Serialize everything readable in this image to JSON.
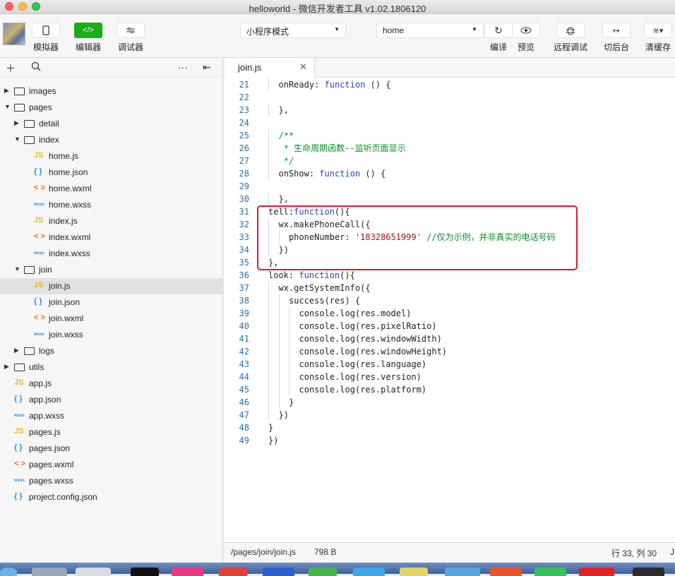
{
  "window": {
    "title": "helloworld - 微信开发者工具 v1.02.1806120"
  },
  "toolbar": {
    "simulator": "模拟器",
    "editor": "编辑器",
    "debugger": "调试器",
    "mode_select": "小程序模式",
    "page_select": "home",
    "compile": "编译",
    "preview": "预览",
    "remote_debug": "远程调试",
    "background": "切后台",
    "clear_cache": "清缓存"
  },
  "sidebar": {
    "tree": [
      {
        "label": "images",
        "type": "folder",
        "depth": 0,
        "expanded": false
      },
      {
        "label": "pages",
        "type": "folder",
        "depth": 0,
        "expanded": true
      },
      {
        "label": "detail",
        "type": "folder",
        "depth": 1,
        "expanded": false
      },
      {
        "label": "index",
        "type": "folder",
        "depth": 1,
        "expanded": true
      },
      {
        "label": "home.js",
        "type": "js",
        "depth": 2
      },
      {
        "label": "home.json",
        "type": "json",
        "depth": 2
      },
      {
        "label": "home.wxml",
        "type": "wxml",
        "depth": 2
      },
      {
        "label": "home.wxss",
        "type": "wxss",
        "depth": 2
      },
      {
        "label": "index.js",
        "type": "js",
        "depth": 2
      },
      {
        "label": "index.wxml",
        "type": "wxml",
        "depth": 2
      },
      {
        "label": "index.wxss",
        "type": "wxss",
        "depth": 2
      },
      {
        "label": "join",
        "type": "folder",
        "depth": 1,
        "expanded": true
      },
      {
        "label": "join.js",
        "type": "js",
        "depth": 2,
        "selected": true
      },
      {
        "label": "join.json",
        "type": "json",
        "depth": 2
      },
      {
        "label": "join.wxml",
        "type": "wxml",
        "depth": 2
      },
      {
        "label": "join.wxss",
        "type": "wxss",
        "depth": 2
      },
      {
        "label": "logs",
        "type": "folder",
        "depth": 1,
        "expanded": false
      },
      {
        "label": "utils",
        "type": "folder",
        "depth": 0,
        "expanded": false
      },
      {
        "label": "app.js",
        "type": "js",
        "depth": 0
      },
      {
        "label": "app.json",
        "type": "json",
        "depth": 0
      },
      {
        "label": "app.wxss",
        "type": "wxss",
        "depth": 0
      },
      {
        "label": "pages.js",
        "type": "js",
        "depth": 0
      },
      {
        "label": "pages.json",
        "type": "json",
        "depth": 0
      },
      {
        "label": "pages.wxml",
        "type": "wxml",
        "depth": 0
      },
      {
        "label": "pages.wxss",
        "type": "wxss",
        "depth": 0
      },
      {
        "label": "project.config.json",
        "type": "json",
        "depth": 0
      }
    ],
    "icon_text": {
      "js": "JS",
      "json": "{ }",
      "wxml": "< >",
      "wxss": "wxss"
    }
  },
  "editor": {
    "tab": "join.js",
    "lines": [
      {
        "n": "21",
        "indent": 1,
        "parts": [
          [
            "onReady: ",
            ""
          ],
          [
            "function",
            "kw"
          ],
          [
            " () {",
            ""
          ]
        ]
      },
      {
        "n": "22",
        "indent": 0,
        "parts": []
      },
      {
        "n": "23",
        "indent": 1,
        "parts": [
          [
            "},",
            ""
          ]
        ]
      },
      {
        "n": "24",
        "indent": 0,
        "parts": []
      },
      {
        "n": "25",
        "indent": 1,
        "parts": [
          [
            "/**",
            "cm"
          ]
        ]
      },
      {
        "n": "26",
        "indent": 1,
        "parts": [
          [
            " * 生命周期函数--监听页面显示",
            "cm"
          ]
        ]
      },
      {
        "n": "27",
        "indent": 1,
        "parts": [
          [
            " */",
            "cm"
          ]
        ]
      },
      {
        "n": "28",
        "indent": 1,
        "parts": [
          [
            "onShow: ",
            ""
          ],
          [
            "function",
            "kw"
          ],
          [
            " () {",
            ""
          ]
        ]
      },
      {
        "n": "29",
        "indent": 0,
        "parts": []
      },
      {
        "n": "30",
        "indent": 1,
        "parts": [
          [
            "},",
            ""
          ]
        ]
      },
      {
        "n": "31",
        "indent": 0,
        "parts": [
          [
            "tell:",
            ""
          ],
          [
            "function",
            "kw"
          ],
          [
            "(){",
            ""
          ]
        ]
      },
      {
        "n": "32",
        "indent": 1,
        "parts": [
          [
            "wx.makePhoneCall({",
            ""
          ]
        ]
      },
      {
        "n": "33",
        "indent": 2,
        "parts": [
          [
            "phoneNumber: ",
            ""
          ],
          [
            "'18328651999'",
            "str"
          ],
          [
            " ",
            ""
          ],
          [
            "//仅为示例，并非真实的电话号码",
            "cm"
          ]
        ]
      },
      {
        "n": "34",
        "indent": 1,
        "parts": [
          [
            "})",
            ""
          ]
        ]
      },
      {
        "n": "35",
        "indent": 0,
        "parts": [
          [
            "},",
            ""
          ]
        ]
      },
      {
        "n": "36",
        "indent": 0,
        "parts": [
          [
            "look: ",
            ""
          ],
          [
            "function",
            "kw"
          ],
          [
            "(){",
            ""
          ]
        ]
      },
      {
        "n": "37",
        "indent": 1,
        "parts": [
          [
            "wx.getSystemInfo({",
            ""
          ]
        ]
      },
      {
        "n": "38",
        "indent": 2,
        "parts": [
          [
            "success(res) {",
            ""
          ]
        ]
      },
      {
        "n": "39",
        "indent": 3,
        "parts": [
          [
            "console.log(res.model)",
            ""
          ]
        ]
      },
      {
        "n": "40",
        "indent": 3,
        "parts": [
          [
            "console.log(res.pixelRatio)",
            ""
          ]
        ]
      },
      {
        "n": "41",
        "indent": 3,
        "parts": [
          [
            "console.log(res.windowWidth)",
            ""
          ]
        ]
      },
      {
        "n": "42",
        "indent": 3,
        "parts": [
          [
            "console.log(res.windowHeight)",
            ""
          ]
        ]
      },
      {
        "n": "43",
        "indent": 3,
        "parts": [
          [
            "console.log(res.language)",
            ""
          ]
        ]
      },
      {
        "n": "44",
        "indent": 3,
        "parts": [
          [
            "console.log(res.version)",
            ""
          ]
        ]
      },
      {
        "n": "45",
        "indent": 3,
        "parts": [
          [
            "console.log(res.platform)",
            ""
          ]
        ]
      },
      {
        "n": "46",
        "indent": 2,
        "parts": [
          [
            "}",
            ""
          ]
        ]
      },
      {
        "n": "47",
        "indent": 1,
        "parts": [
          [
            "})",
            ""
          ]
        ]
      },
      {
        "n": "48",
        "indent": 0,
        "parts": [
          [
            "}",
            ""
          ]
        ]
      },
      {
        "n": "49",
        "indent": 0,
        "parts": [
          [
            "})",
            ""
          ]
        ]
      }
    ]
  },
  "statusbar": {
    "path": "/pages/join/join.js",
    "size": "798 B",
    "cursor": "行 33, 列 30",
    "lang": "J"
  },
  "colors": {
    "accent": "#1aad19",
    "highlight": "#e0192c"
  }
}
